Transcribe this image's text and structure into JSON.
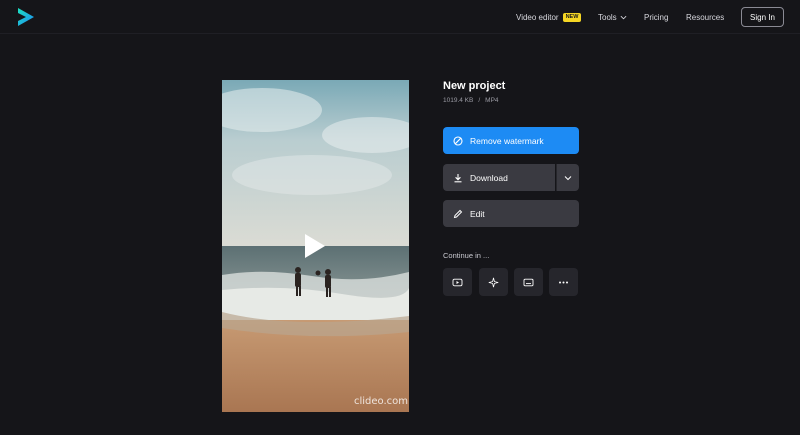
{
  "nav": {
    "video_editor": "Video editor",
    "new_badge": "NEW",
    "tools": "Tools",
    "pricing": "Pricing",
    "resources": "Resources",
    "sign_in": "Sign In"
  },
  "icons": {
    "logo": "clideo-play-logo",
    "tools_chevron": "chevron-down-icon",
    "play": "play-icon",
    "remove_watermark": "no-sign-icon",
    "download": "download-icon",
    "download_dropdown": "chevron-down-icon",
    "edit": "pencil-icon",
    "continue_items": [
      "youtube-icon",
      "sparkle-icon",
      "subtitles-icon",
      "more-icon"
    ]
  },
  "colors": {
    "background": "#151519",
    "primary": "#1d8bf4",
    "badge": "#f5d624",
    "button": "#3a3a41",
    "tile": "#26262c",
    "logo_gradient": [
      "#1de1c0",
      "#1d8bf4"
    ]
  },
  "video": {
    "watermark": "clideo.com"
  },
  "project": {
    "title": "New project",
    "size": "1019.4 KB",
    "separator": "/",
    "format": "MP4"
  },
  "actions": {
    "remove_watermark": "Remove watermark",
    "download": "Download",
    "edit": "Edit"
  },
  "continue": {
    "label": "Continue in ..."
  }
}
